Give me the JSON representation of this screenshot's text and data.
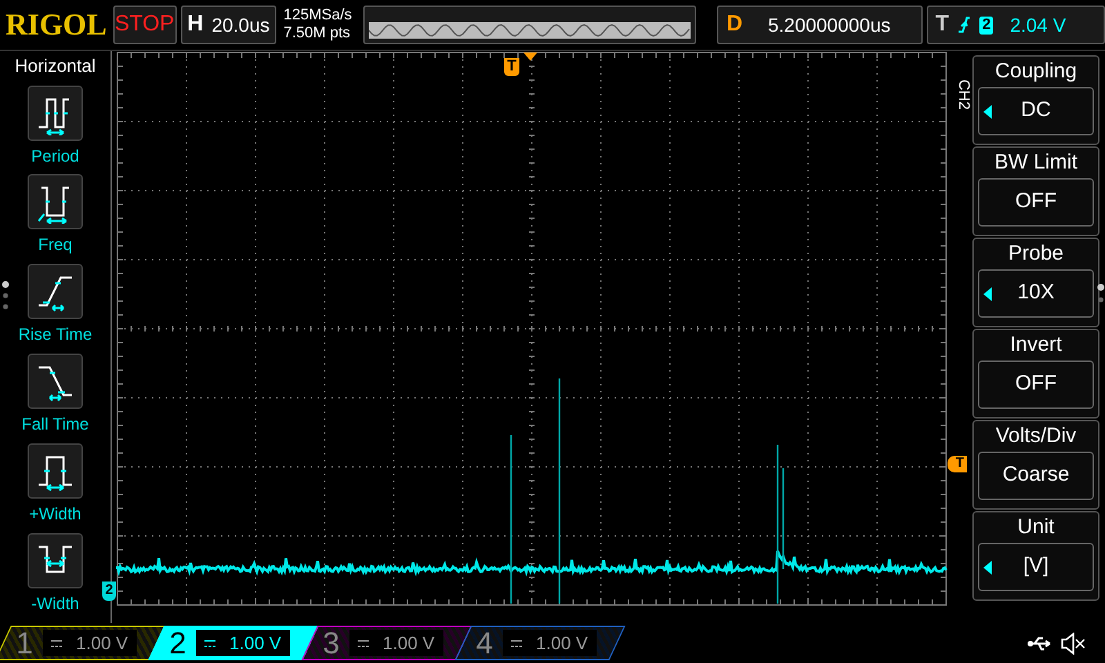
{
  "top_bar": {
    "logo": "RIGOL",
    "run_state": "STOP",
    "timebase": {
      "label": "H",
      "value": "20.0us"
    },
    "sample_rate": "125MSa/s",
    "memory_depth": "7.50M pts",
    "delay": {
      "label": "D",
      "value": "5.20000000us"
    },
    "trigger": {
      "label": "T",
      "source": "2",
      "level": "2.04 V"
    }
  },
  "left_menu": {
    "title": "Horizontal",
    "items": [
      {
        "kind": "period",
        "label": "Period"
      },
      {
        "kind": "freq",
        "label": "Freq"
      },
      {
        "kind": "rise",
        "label": "Rise Time"
      },
      {
        "kind": "fall",
        "label": "Fall Time"
      },
      {
        "kind": "pwidth",
        "label": "+Width"
      },
      {
        "kind": "nwidth",
        "label": "-Width"
      }
    ]
  },
  "markers": {
    "trigger_position": "T",
    "trigger_level": "T",
    "channel": "2"
  },
  "right_menu": {
    "channel": "CH2",
    "items": [
      {
        "title": "Coupling",
        "value": "DC",
        "adjustable": true
      },
      {
        "title": "BW Limit",
        "value": "OFF",
        "adjustable": false
      },
      {
        "title": "Probe",
        "value": "10X",
        "adjustable": true
      },
      {
        "title": "Invert",
        "value": "OFF",
        "adjustable": false
      },
      {
        "title": "Volts/Div",
        "value": "Coarse",
        "adjustable": false
      },
      {
        "title": "Unit",
        "value": "[V]",
        "adjustable": true
      }
    ]
  },
  "channels": [
    {
      "number": "1",
      "scale": "1.00 V",
      "selected": false,
      "color": "#c8c800"
    },
    {
      "number": "2",
      "scale": "1.00 V",
      "selected": true,
      "color": "#00ffff"
    },
    {
      "number": "3",
      "scale": "1.00 V",
      "selected": false,
      "color": "#c000c0"
    },
    {
      "number": "4",
      "scale": "1.00 V",
      "selected": false,
      "color": "#2060c0"
    }
  ]
}
